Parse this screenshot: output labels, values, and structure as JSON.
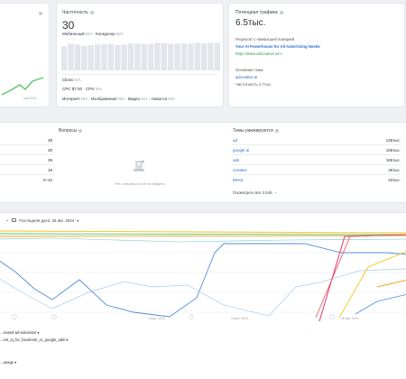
{
  "colors": {
    "accent": "#3b86d6",
    "green": "#57c96a",
    "orange": "#f0a22b",
    "pink": "#e0457b",
    "yellow": "#f4c617",
    "red": "#e8544d"
  },
  "left_card": {
    "date": "янв 2024"
  },
  "frequency": {
    "title": "Частотность",
    "value": "30",
    "mobile_label": "Мобильный",
    "mobile_val": "N/A",
    "competitor_label": "Конкурсер",
    "competitor_val": "N/A",
    "clicks_label": "Clicks",
    "clicks_val": "N/A",
    "cpc_label": "CPC",
    "cpc_val": "$7.00",
    "cps_label": "CPS",
    "cps_val": "N/A",
    "internet_label": "Интернет",
    "internet_val": "N/A",
    "images_label": "Изображения",
    "images_val": "N/A",
    "video_label": "Видео",
    "video_val": "N/A",
    "news_label": "Новости",
    "news_val": "N/A",
    "bars": [
      0.78,
      0.86,
      0.84,
      0.8,
      0.82,
      0.84,
      0.85,
      0.86,
      0.82,
      0.84,
      0.88,
      0.87,
      0.86,
      0.86,
      0.9,
      0.89,
      0.86,
      0.88,
      0.88,
      0.87,
      0.9,
      0.88,
      0.9,
      0.9
    ]
  },
  "traffic": {
    "title": "Потенциал трафика",
    "value": "6.5тыс.",
    "result_label": "Результат с наивысшей позицией",
    "result_title": "Your AI Powerhouse for All Advertising Needs",
    "result_url": "https://www.adcreative.ai/",
    "main_label": "Основная тема",
    "main_value": "adcreative.ai",
    "main_freq": "Частотность 2.7тыс."
  },
  "mid_left": {
    "values": [
      "39",
      "39",
      "39",
      "19",
      "0–10"
    ]
  },
  "questions": {
    "title": "Вопросы",
    "empty_text": "Нет ключевых слов не найдено"
  },
  "ranking": {
    "title": "Темы ранжируются",
    "items": [
      {
        "name": "ad",
        "value": "136тыс."
      },
      {
        "name": "google ai",
        "value": "165тыс."
      },
      {
        "name": "ads",
        "value": "165тыс."
      },
      {
        "name": "creative",
        "value": "46тыс."
      },
      {
        "name": "blend",
        "value": "34тыс."
      }
    ],
    "view_all": "Посмотреть все 2,546"
  },
  "chart": {
    "last_date_label": "Последняя дата: 26 авг. 2024",
    "x_labels": [
      "1 мар. 2024",
      "9 июл. 2024",
      "26 авг. 2024"
    ]
  },
  "bottom": {
    "line1": "...reated-ad-solutions/",
    "line2": "...est_ai_for_facebook_or_google_ads/",
    "line3": "...anage"
  }
}
